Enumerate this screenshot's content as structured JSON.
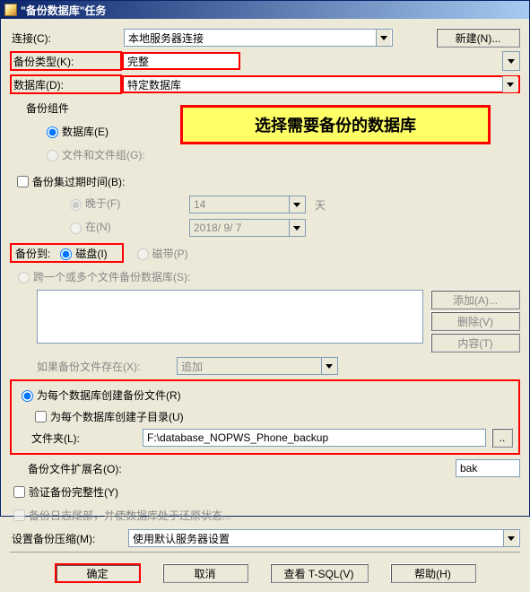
{
  "window": {
    "title": "\"备份数据库\"任务"
  },
  "labels": {
    "connection": "连接(C):",
    "backup_type": "备份类型(K):",
    "database": "数据库(D):",
    "component_group": "备份组件",
    "comp_db": "数据库(E)",
    "comp_files": "文件和文件组(G):",
    "expire_group": "备份集过期时间(B):",
    "expire_after": "晚于(F)",
    "expire_on": "在(N)",
    "backup_to_label": "备份到:",
    "backup_to_disk": "磁盘(I)",
    "backup_to_tape": "磁带(P)",
    "span_files": "跨一个或多个文件备份数据库(S):",
    "if_exists": "如果备份文件存在(X):",
    "create_per_db": "为每个数据库创建备份文件(R)",
    "create_subdir": "为每个数据库创建子目录(U)",
    "folder": "文件夹(L):",
    "ext": "备份文件扩展名(O):",
    "verify": "验证备份完整性(Y)",
    "tail_log": "备份日志尾部，并使数据库处于还原状态...",
    "compression": "设置备份压缩(M):",
    "days_unit": "天"
  },
  "values": {
    "connection": "本地服务器连接",
    "backup_type": "完整",
    "database": "特定数据库",
    "expire_days": "14",
    "expire_date": "2018/ 9/ 7",
    "if_exists_mode": "追加",
    "folder_path": "F:\\database_NOPWS_Phone_backup",
    "ext": "bak",
    "compression": "使用默认服务器设置"
  },
  "callout": {
    "text": "选择需要备份的数据库"
  },
  "buttons": {
    "new": "新建(N)...",
    "add": "添加(A)...",
    "remove": "删除(V)",
    "contents": "内容(T)",
    "browse": "..",
    "ok": "确定",
    "cancel": "取消",
    "view_tsql": "查看 T-SQL(V)",
    "help": "帮助(H)"
  }
}
